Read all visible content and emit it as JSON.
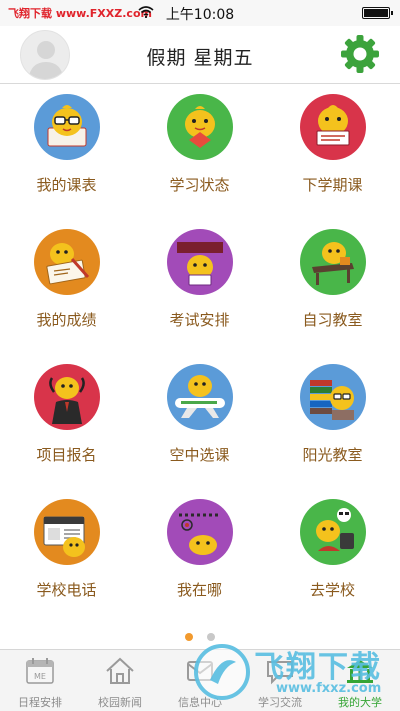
{
  "status_bar": {
    "watermark": "飞翔下载 www.FXXZ.com",
    "time": "上午10:08"
  },
  "header": {
    "title": "假期 星期五"
  },
  "grid": {
    "items": [
      {
        "label": "我的课表",
        "icon": "schedule-icon",
        "color": "#5b9bd8"
      },
      {
        "label": "学习状态",
        "icon": "study-status-icon",
        "color": "#49b649"
      },
      {
        "label": "下学期课",
        "icon": "next-term-icon",
        "color": "#d8344a"
      },
      {
        "label": "我的成绩",
        "icon": "grades-icon",
        "color": "#e38a1f"
      },
      {
        "label": "考试安排",
        "icon": "exam-icon",
        "color": "#a24bb8"
      },
      {
        "label": "自习教室",
        "icon": "study-room-icon",
        "color": "#49b649"
      },
      {
        "label": "项目报名",
        "icon": "registration-icon",
        "color": "#d8344a"
      },
      {
        "label": "空中选课",
        "icon": "course-select-icon",
        "color": "#5b9bd8"
      },
      {
        "label": "阳光教室",
        "icon": "sunshine-classroom-icon",
        "color": "#5b9bd8"
      },
      {
        "label": "学校电话",
        "icon": "phone-card-icon",
        "color": "#e38a1f"
      },
      {
        "label": "我在哪",
        "icon": "location-icon",
        "color": "#a24bb8"
      },
      {
        "label": "去学校",
        "icon": "go-school-icon",
        "color": "#49b649"
      }
    ]
  },
  "pagination": {
    "current": 1,
    "total": 2
  },
  "tabbar": {
    "items": [
      {
        "label": "日程安排",
        "icon": "calendar-icon",
        "active": false
      },
      {
        "label": "校园新闻",
        "icon": "home-icon",
        "active": false
      },
      {
        "label": "信息中心",
        "icon": "message-icon",
        "active": false
      },
      {
        "label": "学习交流",
        "icon": "chat-icon",
        "active": false
      },
      {
        "label": "我的大学",
        "icon": "university-icon",
        "active": true
      }
    ]
  },
  "overlay_watermark": {
    "text": "飞翔下载",
    "url": "www.fxxz.com"
  },
  "colors": {
    "label": "#8a5a1e",
    "gear": "#3ca33c",
    "active_tab": "#35a535",
    "page_dot_active": "#f29a2e"
  }
}
